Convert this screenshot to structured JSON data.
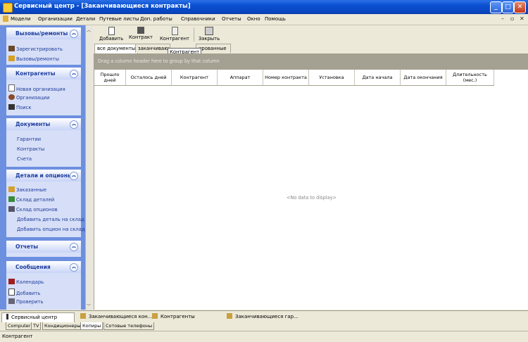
{
  "window": {
    "title": "Сервисный центр  - [Заканчивающиеся контракты]"
  },
  "menu": [
    "Модели",
    "Организации",
    "Детали",
    "Путевые листы",
    "Доп. работы",
    "Справочники",
    "Отчеты",
    "Окно",
    "Помощь"
  ],
  "sidebar": {
    "groups": [
      {
        "title": "Вызовы/ремонты",
        "items": [
          "Зарегистрировать",
          "Вызовы/ремонты"
        ]
      },
      {
        "title": "Контрагенты",
        "items": [
          "Новая организация",
          "Организации",
          "Поиск"
        ]
      },
      {
        "title": "Документы",
        "items": [
          "Гарантии",
          "Контракты",
          "Счета"
        ]
      },
      {
        "title": "Детали и опционы",
        "items": [
          "Заказанные",
          "Склад деталей",
          "Склад опционов",
          "Добавить деталь на склад",
          "Добавить опцион на склад"
        ]
      },
      {
        "title": "Отчеты",
        "items": []
      },
      {
        "title": "Сообщения",
        "items": [
          "Календарь",
          "Добавить",
          "Проверить"
        ]
      }
    ]
  },
  "toolbar": {
    "add": "Добавить",
    "contract": "Контракт",
    "contragent": "Контрагент",
    "close": "Закрыть"
  },
  "tabs": [
    "все документы",
    "заканчивающ",
    "",
    "ированные"
  ],
  "tooltip": "Контрагент",
  "grid": {
    "group_hint": "Drag a column header here to group by that column",
    "columns": [
      "Прошло дней",
      "Осталось дней",
      "Контрагент",
      "Аппарат",
      "Номер контракта",
      "Установка",
      "Дата начала",
      "Дата окончания",
      "Длительность (мес.)"
    ],
    "empty_text": "<No data to display>"
  },
  "doc_tabs": [
    "Сервисный центр",
    "Заканчивающиеся кон...",
    "Контрагенты",
    "Заканчивающиеся гар..."
  ],
  "bottom_tabs": [
    "Computer",
    "TV",
    "Кондиционеры",
    "Копиры",
    "Сотовые телефоны"
  ],
  "status": "Контрагент"
}
